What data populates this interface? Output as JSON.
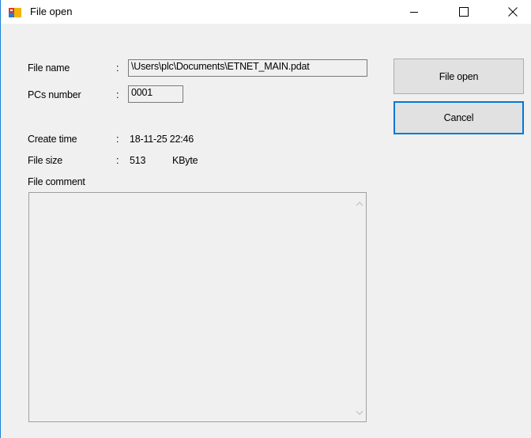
{
  "window": {
    "title": "File open",
    "accent_color": "#0078d7"
  },
  "icons": {
    "app": "app-window-icon",
    "minimize": "minimize-icon",
    "maximize": "maximize-icon",
    "close": "close-icon",
    "scroll_up": "chevron-up-icon",
    "scroll_down": "chevron-down-icon"
  },
  "fields": {
    "file_name_label": "File name",
    "file_name_value": "\\Users\\plc\\Documents\\ETNET_MAIN.pdat",
    "pcs_number_label": "PCs number",
    "pcs_number_value": "0001",
    "create_time_label": "Create time",
    "create_time_value": "18-11-25 22:46",
    "file_size_label": "File size",
    "file_size_value": "513",
    "file_size_unit": "KByte",
    "file_comment_label": "File comment",
    "colon": ":"
  },
  "buttons": {
    "file_open": "File open",
    "cancel": "Cancel"
  }
}
